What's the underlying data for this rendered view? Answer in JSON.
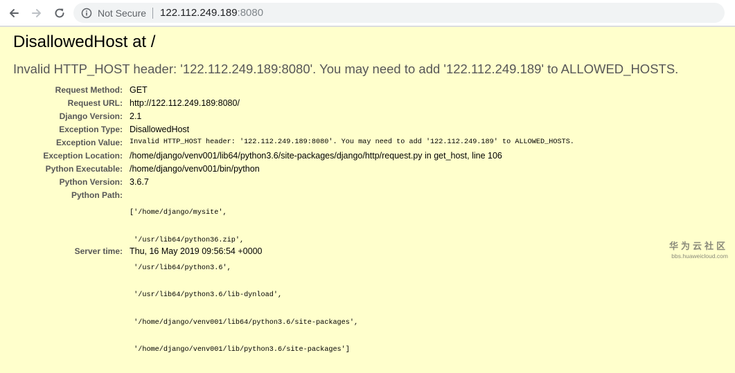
{
  "browser": {
    "security_label": "Not Secure",
    "url_host": "122.112.249.189",
    "url_port": ":8080",
    "icons": {
      "back": "back-arrow-icon",
      "forward": "forward-arrow-icon",
      "reload": "reload-icon",
      "site_info": "info-icon"
    }
  },
  "error": {
    "title": "DisallowedHost at /",
    "message": "Invalid HTTP_HOST header: '122.112.249.189:8080'. You may need to add '122.112.249.189' to ALLOWED_HOSTS."
  },
  "meta": {
    "request_method": {
      "label": "Request Method:",
      "value": "GET"
    },
    "request_url": {
      "label": "Request URL:",
      "value": "http://122.112.249.189:8080/"
    },
    "django_version": {
      "label": "Django Version:",
      "value": "2.1"
    },
    "exception_type": {
      "label": "Exception Type:",
      "value": "DisallowedHost"
    },
    "exception_value": {
      "label": "Exception Value:",
      "value": "Invalid HTTP_HOST header: '122.112.249.189:8080'. You may need to add '122.112.249.189' to ALLOWED_HOSTS."
    },
    "exception_location": {
      "label": "Exception Location:",
      "value": "/home/django/venv001/lib64/python3.6/site-packages/django/http/request.py in get_host, line 106"
    },
    "python_executable": {
      "label": "Python Executable:",
      "value": "/home/django/venv001/bin/python"
    },
    "python_version": {
      "label": "Python Version:",
      "value": "3.6.7"
    },
    "python_path": {
      "label": "Python Path:",
      "lines": [
        "['/home/django/mysite',",
        " '/usr/lib64/python36.zip',",
        " '/usr/lib64/python3.6',",
        " '/usr/lib64/python3.6/lib-dynload',",
        " '/home/django/venv001/lib64/python3.6/site-packages',",
        " '/home/django/venv001/lib/python3.6/site-packages']"
      ]
    },
    "server_time": {
      "label": "Server time:",
      "value": "Thu, 16 May 2019 09:56:54 +0000"
    }
  },
  "watermark": {
    "main": "华为云社区",
    "sub": "bbs.huaweicloud.com"
  }
}
